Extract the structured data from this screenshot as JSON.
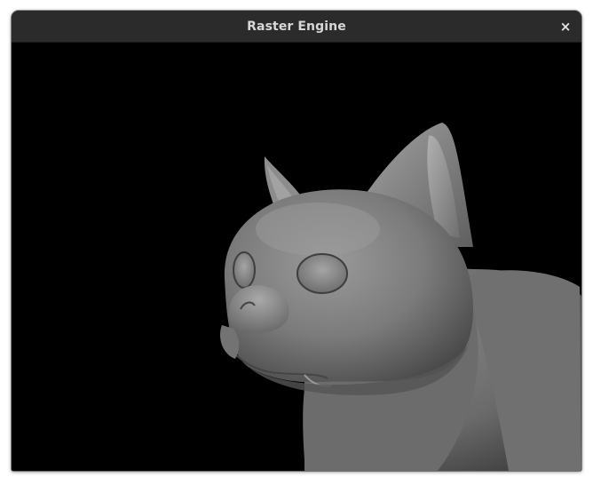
{
  "window": {
    "title": "Raster Engine",
    "close_glyph": "×",
    "close_icon": "close-icon"
  },
  "viewport": {
    "background_color": "#000000",
    "render_subject": "shaded-cat-3d-model"
  },
  "colors": {
    "titlebar": "#2b2b2b",
    "title_text": "#d8d8d8",
    "model_base": "#7a7a7a"
  }
}
